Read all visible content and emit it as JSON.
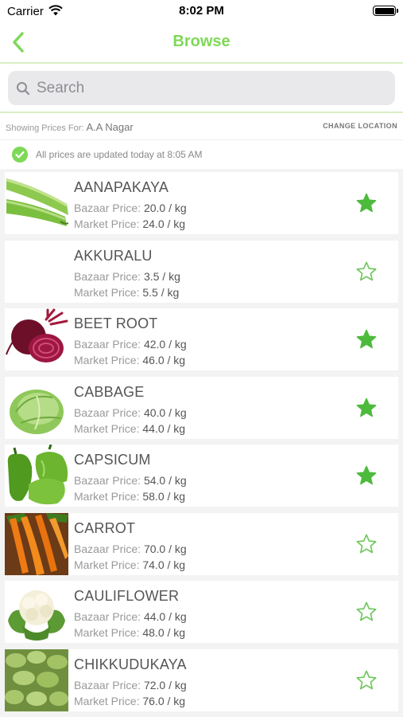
{
  "status_bar": {
    "carrier": "Carrier",
    "time": "8:02 PM"
  },
  "nav": {
    "title": "Browse",
    "back_icon": "chevron-left-icon"
  },
  "search": {
    "placeholder": "Search",
    "value": ""
  },
  "location": {
    "label": "Showing Prices For:",
    "name": "A.A Nagar",
    "change_label": "CHANGE LOCATION"
  },
  "updated": {
    "text": "All prices are updated today at 8:05 AM"
  },
  "colors": {
    "accent": "#7ed957",
    "star_filled": "#4cbb3b",
    "check": "#7ed957"
  },
  "items": [
    {
      "name": "AANAPAKAYA",
      "bazaar_label": "Bazaar Price:",
      "bazaar": "20.0 / kg",
      "market_label": "Market Price:",
      "market": "24.0 / kg",
      "favorite": true,
      "image": "bottle-gourd"
    },
    {
      "name": "AKKURALU",
      "bazaar_label": "Bazaar Price:",
      "bazaar": "3.5 / kg",
      "market_label": "Market Price:",
      "market": "5.5 / kg",
      "favorite": false,
      "image": "none"
    },
    {
      "name": "BEET ROOT",
      "bazaar_label": "Bazaar Price:",
      "bazaar": "42.0 / kg",
      "market_label": "Market Price:",
      "market": "46.0 / kg",
      "favorite": true,
      "image": "beetroot"
    },
    {
      "name": "CABBAGE",
      "bazaar_label": "Bazaar Price:",
      "bazaar": "40.0 / kg",
      "market_label": "Market Price:",
      "market": "44.0 / kg",
      "favorite": true,
      "image": "cabbage"
    },
    {
      "name": "CAPSICUM",
      "bazaar_label": "Bazaar Price:",
      "bazaar": "54.0 / kg",
      "market_label": "Market Price:",
      "market": "58.0 / kg",
      "favorite": true,
      "image": "capsicum"
    },
    {
      "name": "CARROT",
      "bazaar_label": "Bazaar Price:",
      "bazaar": "70.0 / kg",
      "market_label": "Market Price:",
      "market": "74.0 / kg",
      "favorite": false,
      "image": "carrot"
    },
    {
      "name": "CAULIFLOWER",
      "bazaar_label": "Bazaar Price:",
      "bazaar": "44.0 / kg",
      "market_label": "Market Price:",
      "market": "48.0 / kg",
      "favorite": false,
      "image": "cauliflower"
    },
    {
      "name": "CHIKKUDUKAYA",
      "bazaar_label": "Bazaar Price:",
      "bazaar": "72.0 / kg",
      "market_label": "Market Price:",
      "market": "76.0 / kg",
      "favorite": false,
      "image": "broad-beans"
    }
  ]
}
